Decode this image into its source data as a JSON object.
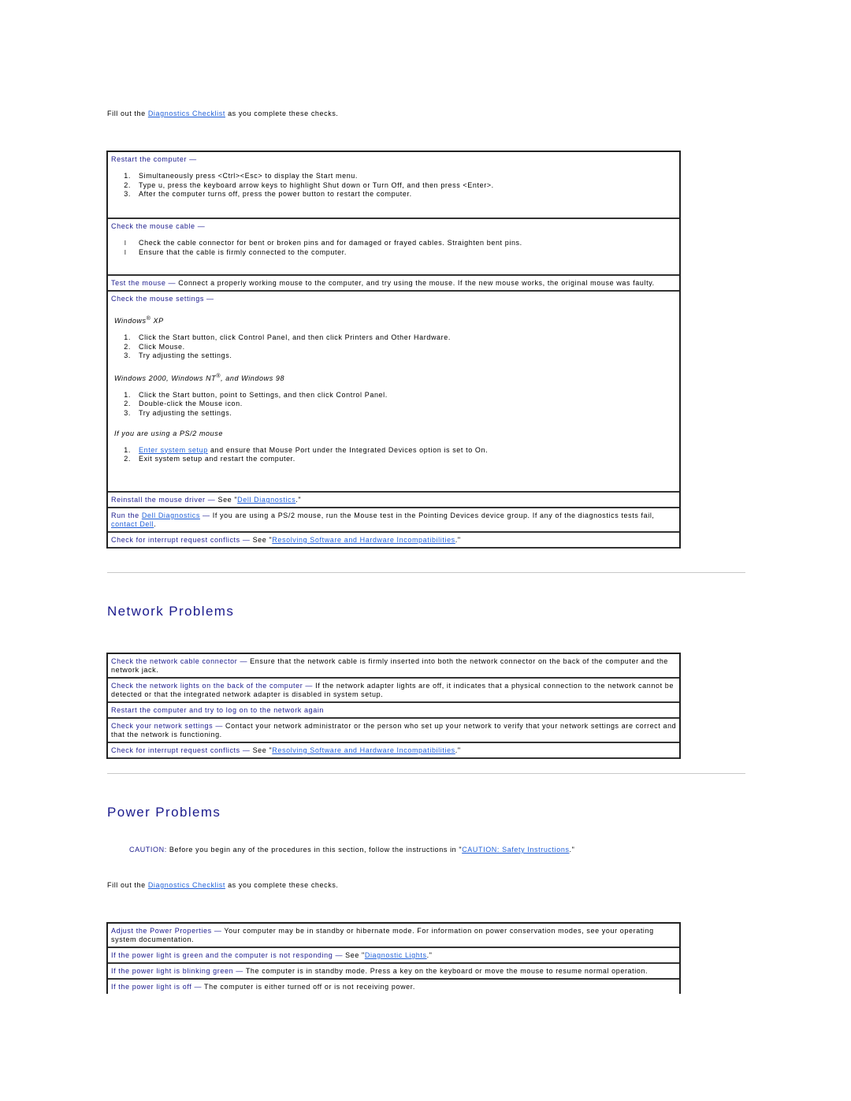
{
  "intro1": {
    "pre": "Fill out the ",
    "link": "Diagnostics Checklist",
    "post": " as you complete these checks."
  },
  "mouse": {
    "restart": {
      "title": "Restart the computer —",
      "steps": [
        "Simultaneously press <Ctrl><Esc> to display the Start menu.",
        "Type u, press the keyboard arrow keys to highlight Shut down or Turn Off, and then press <Enter>.",
        "After the computer turns off, press the power button to restart the computer."
      ]
    },
    "cable": {
      "title": "Check the mouse cable —",
      "bullet_glyph": "l",
      "items": [
        "Check the cable connector for bent or broken pins and for damaged or frayed cables. Straighten bent pins.",
        "Ensure that the cable is firmly connected to the computer."
      ]
    },
    "test": {
      "title": "Test the mouse —",
      "text": " Connect a properly working mouse to the computer, and try using the mouse. If the new mouse works, the original mouse was faulty."
    },
    "settings": {
      "title": "Check the mouse settings —",
      "xp_label": "Windows",
      "xp_suffix": " XP",
      "reg": "®",
      "xp_steps": [
        "Click the Start button, click Control Panel, and then click Printers and Other Hardware.",
        "Click Mouse.",
        "Try adjusting the settings."
      ],
      "w2k_label_a": "Windows 2000, Windows NT",
      "w2k_label_b": ", and Windows 98",
      "w2k_steps": [
        "Click the Start button, point to Settings, and then click Control Panel.",
        "Double-click the Mouse icon.",
        "Try adjusting the settings."
      ],
      "ps2_label": "If you are using a PS/2 mouse",
      "ps2_step1_link": "Enter system setup",
      "ps2_step1_text": " and ensure that Mouse Port under the Integrated Devices option is set to On.",
      "ps2_step2": "Exit system setup and restart the computer."
    },
    "reinstall": {
      "title": "Reinstall the mouse driver —",
      "pre": " See \"",
      "link": "Dell Diagnostics",
      "post": ".\""
    },
    "run_diag": {
      "title_pre": "Run the ",
      "title_link": "Dell Diagnostics",
      "title_post": " —",
      "text": " If you are using a PS/2 mouse, run the Mouse test in the Pointing Devices device group. If any of the diagnostics tests fail, ",
      "link2": "contact Dell",
      "post": "."
    },
    "irq": {
      "title": "Check for interrupt request conflicts —",
      "pre": " See \"",
      "link": "Resolving Software and Hardware Incompatibilities",
      "post": ".\""
    }
  },
  "network": {
    "heading": "Network Problems",
    "rows": [
      {
        "title": "Check the network cable connector —",
        "text": " Ensure that the network cable is firmly inserted into both the network connector on the back of the computer and the network jack."
      },
      {
        "title": "Check the network lights on the back of the computer —",
        "text": " If the network adapter lights are off, it indicates that a physical connection to the network cannot be detected or that the integrated network adapter is disabled in system setup."
      },
      {
        "title": "Restart the computer and try to log on to the network again",
        "text": ""
      },
      {
        "title": "Check your network settings —",
        "text": " Contact your network administrator or the person who set up your network to verify that your network settings are correct and that the network is functioning."
      }
    ],
    "irq": {
      "title": "Check for interrupt request conflicts —",
      "pre": " See \"",
      "link": "Resolving Software and Hardware Incompatibilities",
      "post": ".\""
    }
  },
  "power": {
    "heading": "Power Problems",
    "caution": {
      "label": "CAUTION:",
      "text": " Before you begin any of the procedures in this section, follow the instructions in \"",
      "link": "CAUTION: Safety Instructions",
      "post": ".\""
    },
    "intro": {
      "pre": "Fill out the ",
      "link": "Diagnostics Checklist",
      "post": " as you complete these checks."
    },
    "rows": [
      {
        "title": "Adjust the Power Properties —",
        "text": " Your computer may be in standby or hibernate mode. For information on power conservation modes, see your operating system documentation."
      },
      {
        "title": "If the power light is green and the computer is not responding —",
        "pre": " See \"",
        "link": "Diagnostic Lights",
        "post": ".\""
      },
      {
        "title": "If the power light is blinking green —",
        "text": " The computer is in standby mode. Press a key on the keyboard or move the mouse to resume normal operation."
      },
      {
        "title": "If the power light is off —",
        "text": " The computer is either turned off or is not receiving power."
      }
    ]
  }
}
